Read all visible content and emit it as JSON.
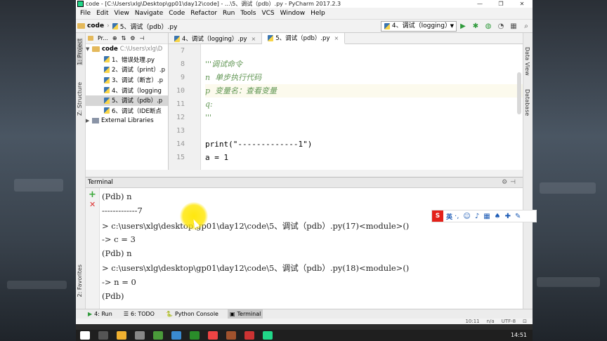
{
  "window": {
    "title": "code - [C:\\Users\\xlg\\Desktop\\gp01\\day12\\code] - ...\\5、调试（pdb）.py - PyCharm 2017.2.3",
    "controls": [
      "—",
      "❐",
      "✕"
    ]
  },
  "menu": [
    "File",
    "Edit",
    "View",
    "Navigate",
    "Code",
    "Refactor",
    "Run",
    "Tools",
    "VCS",
    "Window",
    "Help"
  ],
  "breadcrumb": {
    "folder": "code",
    "file": "5、调试（pdb）.py"
  },
  "run_config": {
    "selected": "4、调试（logging）"
  },
  "left_tabs": {
    "project": "1: Project",
    "structure": "Z: Structure",
    "favorites": "2: Favorites"
  },
  "right_tabs": {
    "dataview": "Data View",
    "database": "Database"
  },
  "project_tool": {
    "label": "Pr...",
    "icons": [
      "⊕",
      "⇅",
      "⚙",
      "⊣"
    ]
  },
  "tree": {
    "root": {
      "name": "code",
      "path": "C:\\Users\\xlg\\D"
    },
    "items": [
      "1、错误处理.py",
      "2、调试（print）.p",
      "3、调试（断言）.p",
      "4、调试（logging",
      "5、调试（pdb）.p",
      "6、调试（IDE断点"
    ],
    "selected_index": 4,
    "external": "External Libraries"
  },
  "tabs": [
    {
      "label": "4、调试（logging）.py",
      "active": false
    },
    {
      "label": "5、调试（pdb）.py",
      "active": true
    }
  ],
  "editor": {
    "line_numbers": [
      "7",
      "8",
      "9",
      "10",
      "11",
      "12",
      "13",
      "14",
      "15"
    ],
    "lines": [
      "",
      "'''调试命令",
      "n  单步执行代码",
      "p  变量名：查看变量",
      "q:",
      "'''",
      "",
      "print(\"-------------1\")",
      "a = 1"
    ],
    "highlight_line": 3
  },
  "terminal": {
    "title": "Terminal",
    "lines": [
      "(Pdb) n",
      "-------------7",
      "> c:\\users\\xlg\\desktop\\gp01\\day12\\code\\5、调试（pdb）.py(17)<module>()",
      "-> c = 3",
      "(Pdb) n",
      "> c:\\users\\xlg\\desktop\\gp01\\day12\\code\\5、调试（pdb）.py(18)<module>()",
      "-> n = 0",
      "(Pdb)"
    ]
  },
  "ime": {
    "logo": "S",
    "mode": "英"
  },
  "toolbuttons": [
    {
      "icon": "▶",
      "label": "4: Run",
      "active": false
    },
    {
      "icon": "☰",
      "label": "6: TODO",
      "active": false
    },
    {
      "icon": "🐍",
      "label": "Python Console",
      "active": false
    },
    {
      "icon": "▣",
      "label": "Terminal",
      "active": true
    }
  ],
  "status": {
    "position": "10:11",
    "na": "n/a",
    "encoding": "UTF-8"
  },
  "clock": {
    "time": "14:51"
  }
}
